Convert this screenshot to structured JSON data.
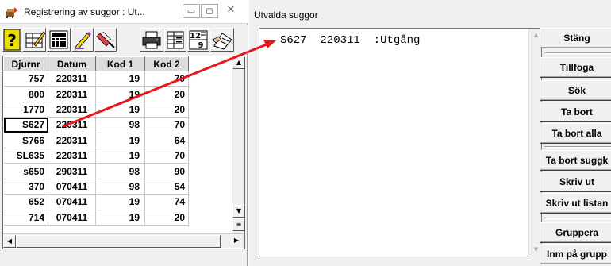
{
  "left_window": {
    "title": "Registrering av suggor : Ut...",
    "window_buttons": {
      "minimize": "▭",
      "maximize": "◻",
      "close": "✕"
    },
    "toolbar_icons": [
      "help-icon",
      "edit-record-icon",
      "calculator-icon",
      "pencil-icon",
      "eraser-icon",
      "printer-icon",
      "grid-view-icon",
      "calendar-date-icon",
      "calculator-hand-icon"
    ],
    "calendar_icon_top": "12",
    "calendar_icon_bottom": "9",
    "table": {
      "columns": [
        "Djurnr",
        "Datum",
        "Kod 1",
        "Kod 2"
      ],
      "rows": [
        [
          "757",
          "220311",
          "19",
          "70"
        ],
        [
          "800",
          "220311",
          "19",
          "20"
        ],
        [
          "1770",
          "220311",
          "19",
          "20"
        ],
        [
          "S627",
          "220311",
          "98",
          "70"
        ],
        [
          "S766",
          "220311",
          "19",
          "64"
        ],
        [
          "SL635",
          "220311",
          "19",
          "70"
        ],
        [
          "s650",
          "290311",
          "98",
          "90"
        ],
        [
          "370",
          "070411",
          "98",
          "54"
        ],
        [
          "652",
          "070411",
          "19",
          "74"
        ],
        [
          "714",
          "070411",
          "19",
          "20"
        ]
      ],
      "selected_row": 3
    },
    "scroll": {
      "up": "▲",
      "down": "▼",
      "left": "◀",
      "right": "▶"
    }
  },
  "right_window": {
    "title": "Utvalda suggor",
    "list_items": [
      "S627  220311  :Utgång"
    ],
    "buttons": {
      "close": "Stäng",
      "add": "Tillfoga",
      "search": "Sök",
      "remove": "Ta bort",
      "remove_all": "Ta bort alla",
      "remove_sow": "Ta bort suggk",
      "print": "Skriv ut",
      "print_list": "Skriv ut listan",
      "group": "Gruppera",
      "group_entry": "Inm på grupp"
    }
  },
  "colors": {
    "arrow": "#e8151b",
    "window_bg": "#f0f0f0",
    "help_icon": "#e8e000",
    "list_text": "#000000"
  }
}
